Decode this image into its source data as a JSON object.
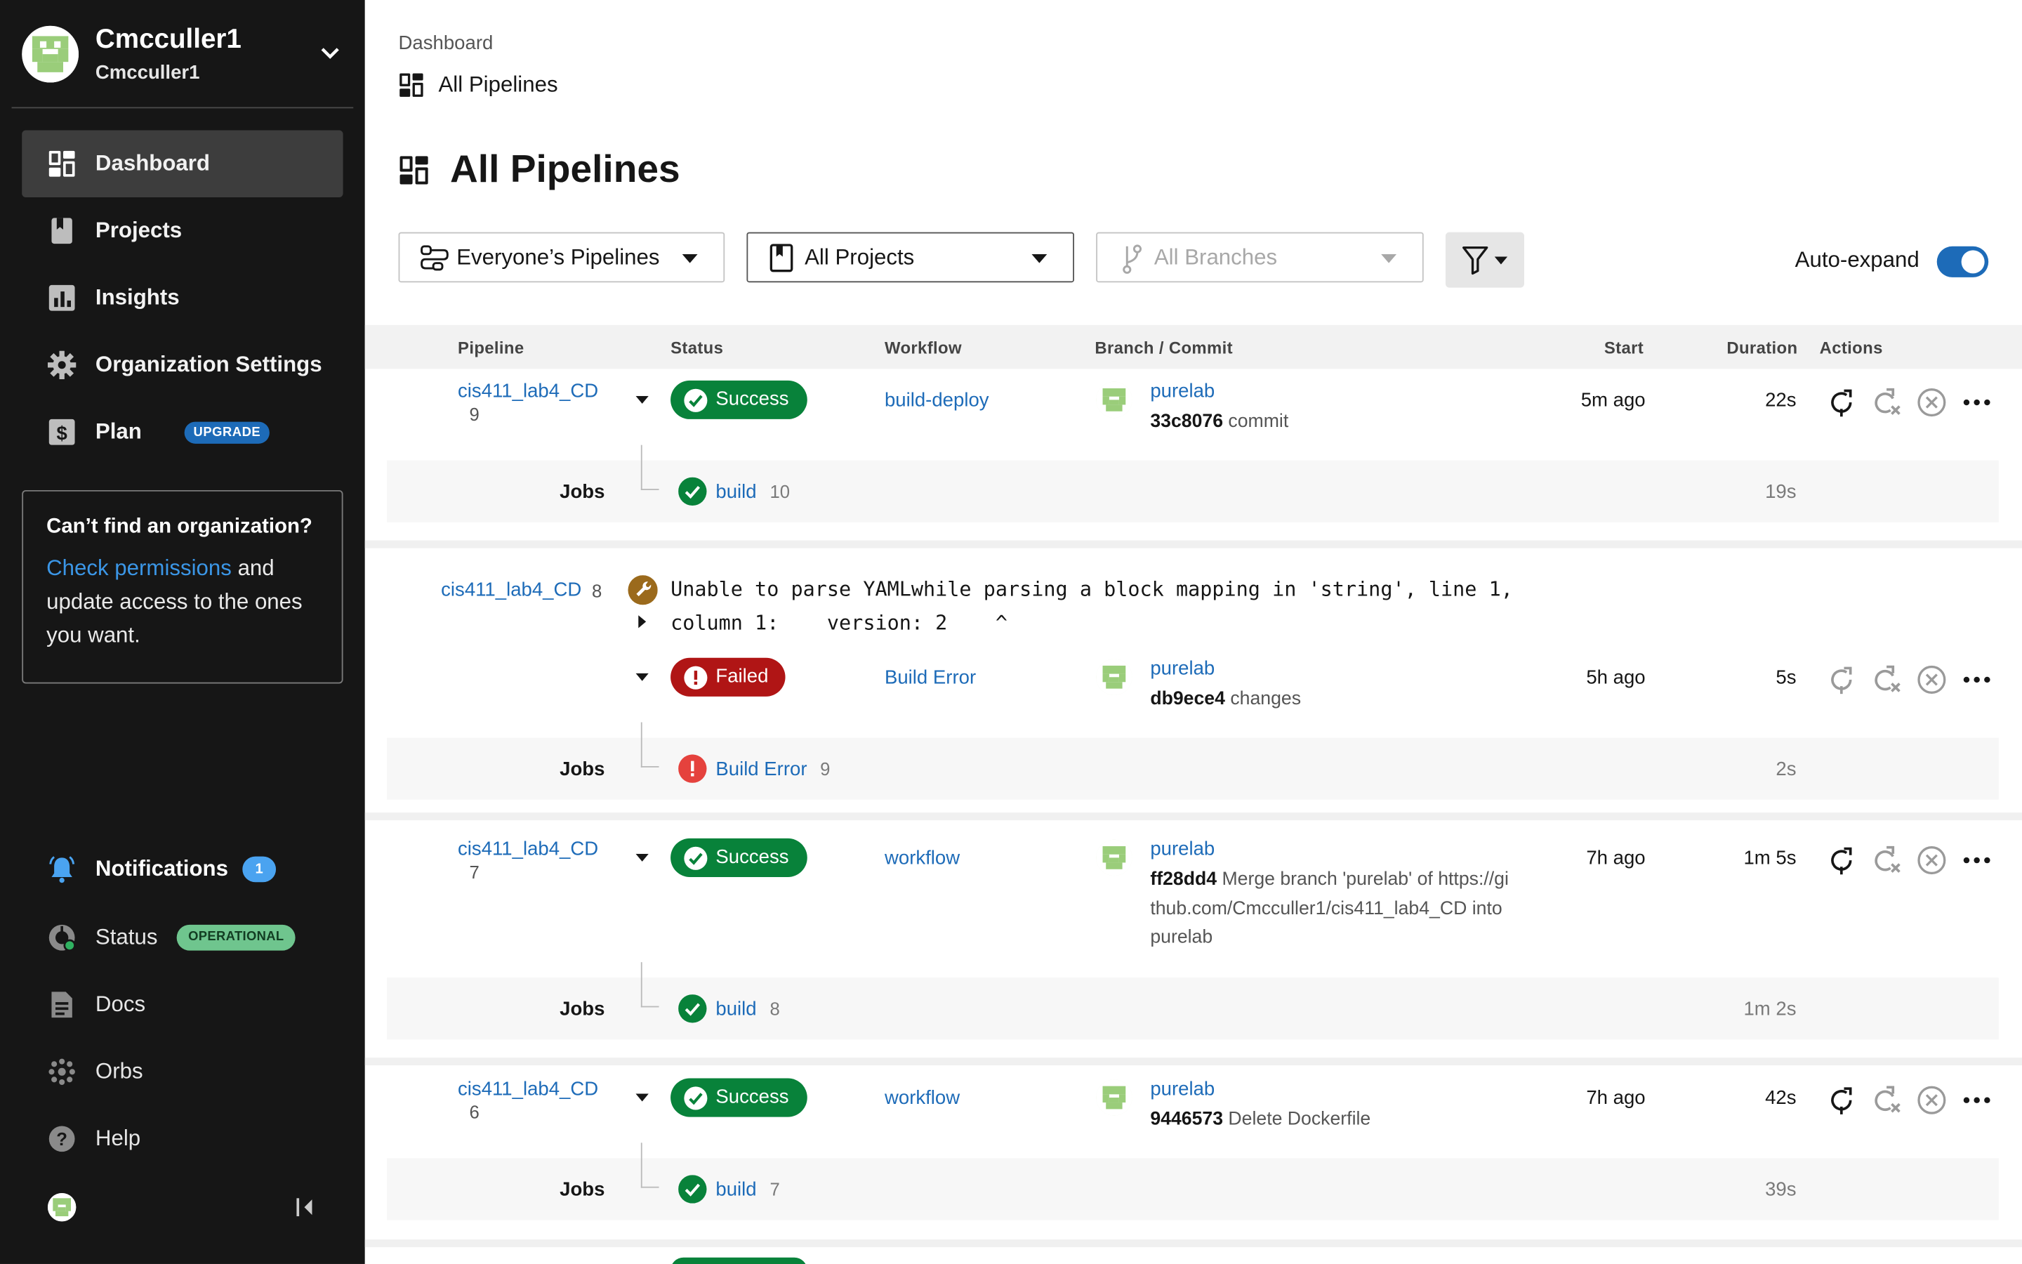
{
  "account": {
    "name": "Cmcculler1",
    "org": "Cmcculler1"
  },
  "sidebar": {
    "nav": [
      {
        "label": "Dashboard",
        "icon": "dashboard-icon"
      },
      {
        "label": "Projects",
        "icon": "projects-icon"
      },
      {
        "label": "Insights",
        "icon": "insights-icon"
      },
      {
        "label": "Organization Settings",
        "icon": "gear-icon"
      },
      {
        "label": "Plan",
        "icon": "dollar-icon",
        "badge": "UPGRADE"
      }
    ],
    "org_box": {
      "title": "Can’t find an organization?",
      "link": "Check permissions",
      "text": " and update access to the ones you want."
    },
    "bottom": [
      {
        "label": "Notifications",
        "icon": "bell-icon",
        "count": "1"
      },
      {
        "label": "Status",
        "icon": "status-gauge-icon",
        "badge": "OPERATIONAL"
      },
      {
        "label": "Docs",
        "icon": "docs-icon"
      },
      {
        "label": "Orbs",
        "icon": "orbs-icon"
      },
      {
        "label": "Help",
        "icon": "help-icon"
      }
    ]
  },
  "breadcrumb": {
    "parent": "Dashboard",
    "current": "All Pipelines"
  },
  "page_title": "All Pipelines",
  "filters": {
    "pipelines": "Everyone’s Pipelines",
    "projects": "All Projects",
    "branches": "All Branches",
    "auto_expand_label": "Auto-expand",
    "auto_expand_on": true
  },
  "table": {
    "headers": [
      "Pipeline",
      "Status",
      "Workflow",
      "Branch / Commit",
      "Start",
      "Duration",
      "Actions"
    ],
    "jobs_label": "Jobs",
    "rows": [
      {
        "pipeline": "cis411_lab4_CD",
        "number": "9",
        "status": "Success",
        "workflow": "build-deploy",
        "branch": "purelab",
        "sha": "33c8076",
        "message": "commit",
        "start": "5m ago",
        "duration": "22s",
        "job": {
          "name": "build",
          "number": "10",
          "duration": "19s"
        }
      },
      {
        "pipeline": "cis411_lab4_CD",
        "number": "8",
        "error": "Unable to parse YAMLwhile parsing a block mapping in 'string', line 1,\ncolumn 1:    version: 2    ^",
        "status": "Failed",
        "workflow": "Build Error",
        "branch": "purelab",
        "sha": "db9ece4",
        "message": "changes",
        "start": "5h ago",
        "duration": "5s",
        "job": {
          "name": "Build Error",
          "number": "9",
          "duration": "2s"
        }
      },
      {
        "pipeline": "cis411_lab4_CD",
        "number": "7",
        "status": "Success",
        "workflow": "workflow",
        "branch": "purelab",
        "sha": "ff28dd4",
        "message": "Merge branch 'purelab' of https://github.com/Cmcculler1/cis411_lab4_CD into purelab",
        "start": "7h ago",
        "duration": "1m 5s",
        "job": {
          "name": "build",
          "number": "8",
          "duration": "1m 2s"
        }
      },
      {
        "pipeline": "cis411_lab4_CD",
        "number": "6",
        "status": "Success",
        "workflow": "workflow",
        "branch": "purelab",
        "sha": "9446573",
        "message": "Delete Dockerfile",
        "start": "7h ago",
        "duration": "42s",
        "job": {
          "name": "build",
          "number": "7",
          "duration": "39s"
        }
      }
    ]
  },
  "colors": {
    "sidebar_bg": "#161616",
    "link": "#1d6bb8",
    "success": "#08823a",
    "failed": "#b01515",
    "accent": "#1d6bb8"
  }
}
